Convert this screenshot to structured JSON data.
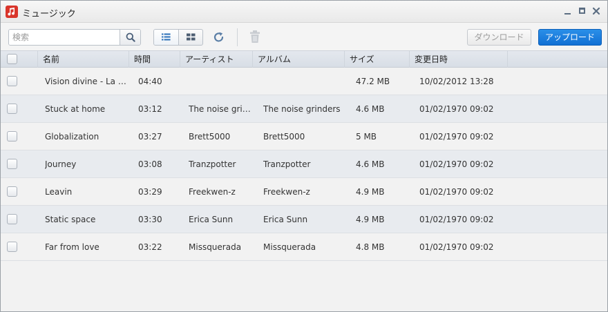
{
  "window": {
    "title": "ミュージック",
    "accent_color": "#1270d4",
    "app_icon": "music-note-icon"
  },
  "toolbar": {
    "search_placeholder": "検索",
    "download_label": "ダウンロード",
    "upload_label": "アップロード"
  },
  "table": {
    "columns": {
      "name": "名前",
      "time": "時間",
      "artist": "アーティスト",
      "album": "アルバム",
      "size": "サイズ",
      "modified": "変更日時"
    },
    "rows": [
      {
        "name": "Vision divine - La Vita Fugge",
        "time": "04:40",
        "artist": "",
        "album": "",
        "size": "47.2 MB",
        "modified": "10/02/2012 13:28"
      },
      {
        "name": "Stuck at home",
        "time": "03:12",
        "artist": "The noise grinders",
        "album": "The noise grinders",
        "size": "4.6 MB",
        "modified": "01/02/1970 09:02"
      },
      {
        "name": "Globalization",
        "time": "03:27",
        "artist": "Brett5000",
        "album": "Brett5000",
        "size": "5 MB",
        "modified": "01/02/1970 09:02"
      },
      {
        "name": "Journey",
        "time": "03:08",
        "artist": "Tranzpotter",
        "album": "Tranzpotter",
        "size": "4.6 MB",
        "modified": "01/02/1970 09:02"
      },
      {
        "name": "Leavin",
        "time": "03:29",
        "artist": "Freekwen-z",
        "album": "Freekwen-z",
        "size": "4.9 MB",
        "modified": "01/02/1970 09:02"
      },
      {
        "name": "Static space",
        "time": "03:30",
        "artist": "Erica Sunn",
        "album": "Erica Sunn",
        "size": "4.9 MB",
        "modified": "01/02/1970 09:02"
      },
      {
        "name": "Far from love",
        "time": "03:22",
        "artist": "Missquerada",
        "album": "Missquerada",
        "size": "4.8 MB",
        "modified": "01/02/1970 09:02"
      }
    ]
  }
}
